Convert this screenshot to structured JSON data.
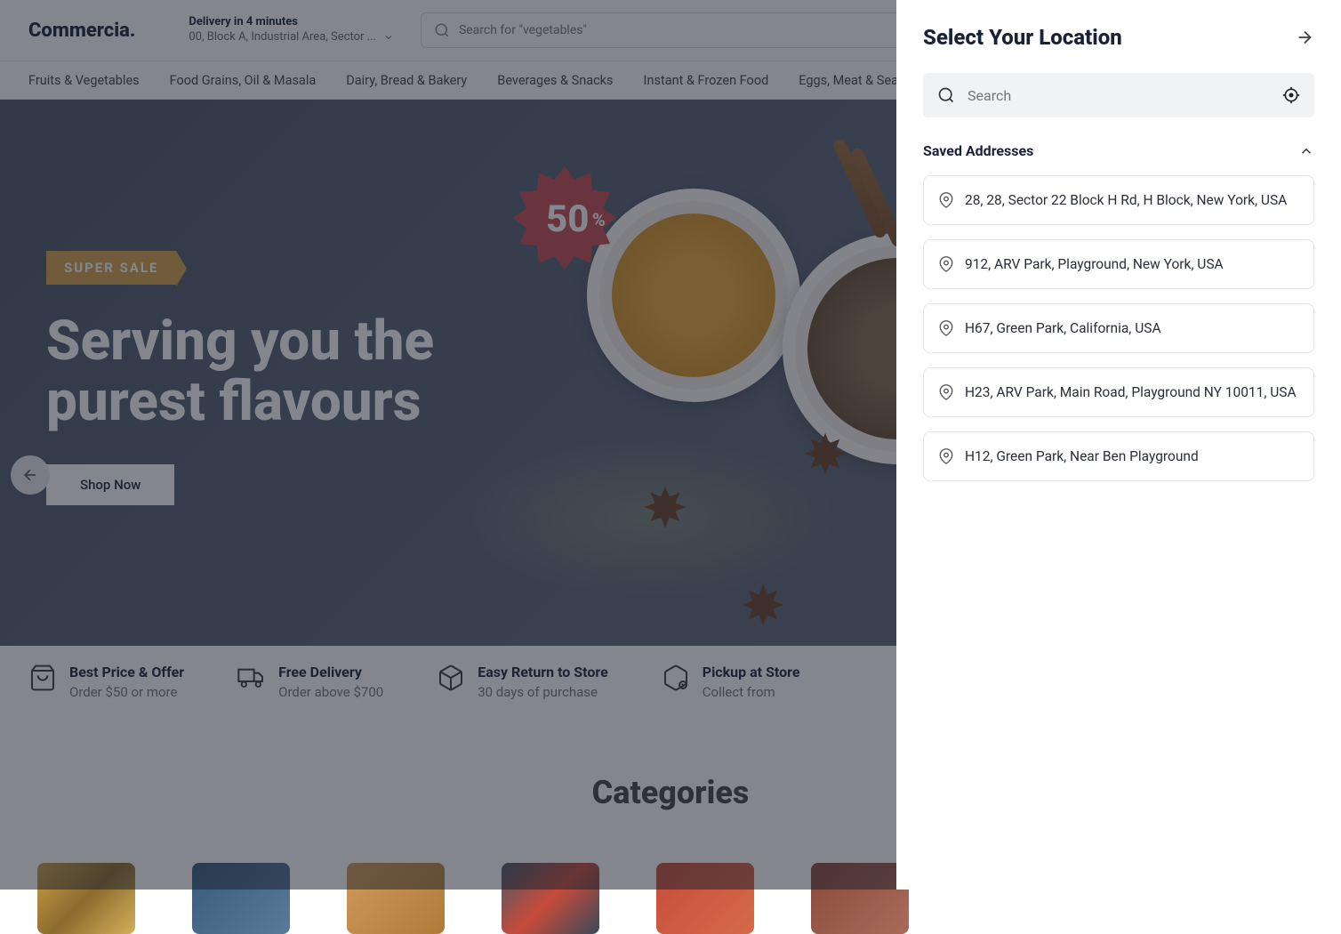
{
  "header": {
    "logo": "Commercia.",
    "delivery_time": "Delivery in 4 minutes",
    "delivery_address": "00, Block A, Industrial Area, Sector ...",
    "search_placeholder": "Search for \"vegetables\""
  },
  "categories_nav": [
    "Fruits & Vegetables",
    "Food Grains, Oil & Masala",
    "Dairy, Bread & Bakery",
    "Beverages & Snacks",
    "Instant & Frozen Food",
    "Eggs, Meat & Seafood"
  ],
  "hero": {
    "badge_label": "SUPER SALE",
    "discount_value": "50",
    "discount_suffix": "%",
    "title_line1": "Serving you the",
    "title_line2": "purest flavours",
    "cta": "Shop Now"
  },
  "features": [
    {
      "title": "Best Price & Offer",
      "sub": "Order $50 or more",
      "icon": "bag"
    },
    {
      "title": "Free Delivery",
      "sub": "Order above $700",
      "icon": "truck"
    },
    {
      "title": "Easy Return to Store",
      "sub": "30 days of purchase",
      "icon": "box"
    },
    {
      "title": "Pickup at Store",
      "sub": "Collect from",
      "icon": "pickup"
    }
  ],
  "categories_heading": "Categories",
  "panel": {
    "title": "Select Your Location",
    "search_placeholder": "Search",
    "saved_label": "Saved Addresses",
    "addresses": [
      "28, 28, Sector 22 Block H Rd, H Block, New York, USA",
      "912, ARV Park, Playground, New York, USA",
      "H67, Green Park, California, USA",
      "H23, ARV Park, Main Road,  Playground NY 10011, USA",
      "H12, Green Park, Near Ben Playground"
    ]
  }
}
